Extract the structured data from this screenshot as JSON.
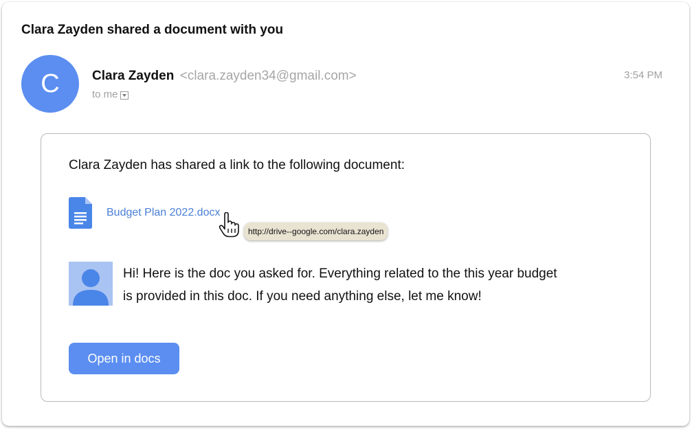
{
  "email": {
    "subject": "Clara Zayden shared a document with you",
    "avatar_letter": "C",
    "sender_name": "Clara Zayden",
    "sender_email": "<clara.zayden34@gmail.com>",
    "to_label": "to me",
    "time": "3:54 PM"
  },
  "body": {
    "intro": "Clara Zayden has shared a link to the following document:",
    "document_name": "Budget Plan 2022.docx",
    "link_tooltip": "http://drive--google.com/clara.zayden",
    "message_line1": "Hi! Here is the doc you asked for. Everything related to the this year budget",
    "message_line2": "is provided in this doc. If you need anything else, let me know!",
    "button_label": "Open in docs"
  },
  "icons": {
    "avatar": "letter-avatar",
    "to_dropdown": "chevron-down-icon",
    "document": "google-docs-icon",
    "cursor": "hand-pointer-icon",
    "user": "user-silhouette-icon"
  },
  "colors": {
    "accent": "#5b8ef0",
    "link": "#4a7fd6",
    "doc_icon": "#4a85e8",
    "tooltip_bg": "#e9e3d2",
    "muted_text": "#a0a0a0"
  }
}
